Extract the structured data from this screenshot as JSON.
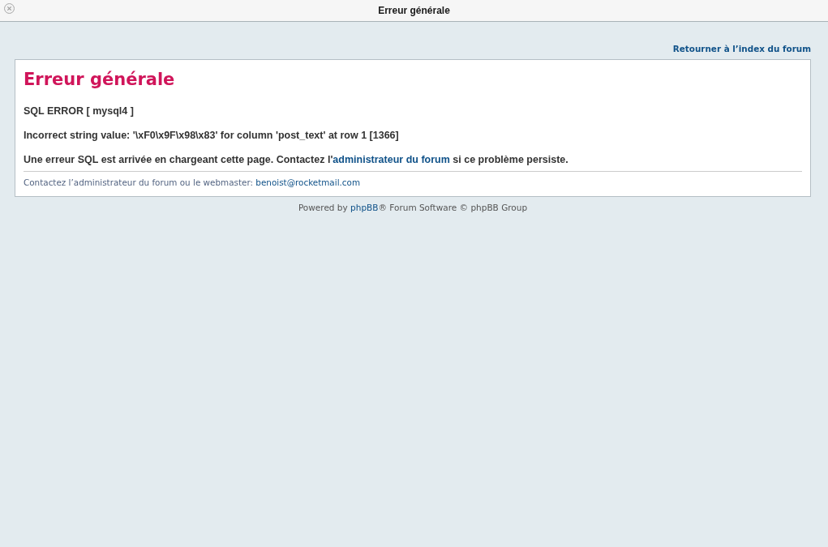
{
  "window": {
    "title": "Erreur générale"
  },
  "nav": {
    "back_link": "Retourner à l’index du forum"
  },
  "panel": {
    "heading": "Erreur générale",
    "sql_error": "SQL ERROR [ mysql4 ]",
    "message": "Incorrect string value: '\\xF0\\x9F\\x98\\x83' for column 'post_text' at row 1 [1366]",
    "notice": {
      "before": "Une erreur SQL est arrivée en chargeant cette page. Contactez l'",
      "link": "administrateur du forum",
      "after": " si ce problème persiste."
    },
    "contact": {
      "before": "Contactez l’administrateur du forum ou le webmaster: ",
      "link": "benoist@rocketmail.com"
    }
  },
  "footer": {
    "before": "Powered by ",
    "link": "phpBB",
    "after": "® Forum Software © phpBB Group"
  }
}
